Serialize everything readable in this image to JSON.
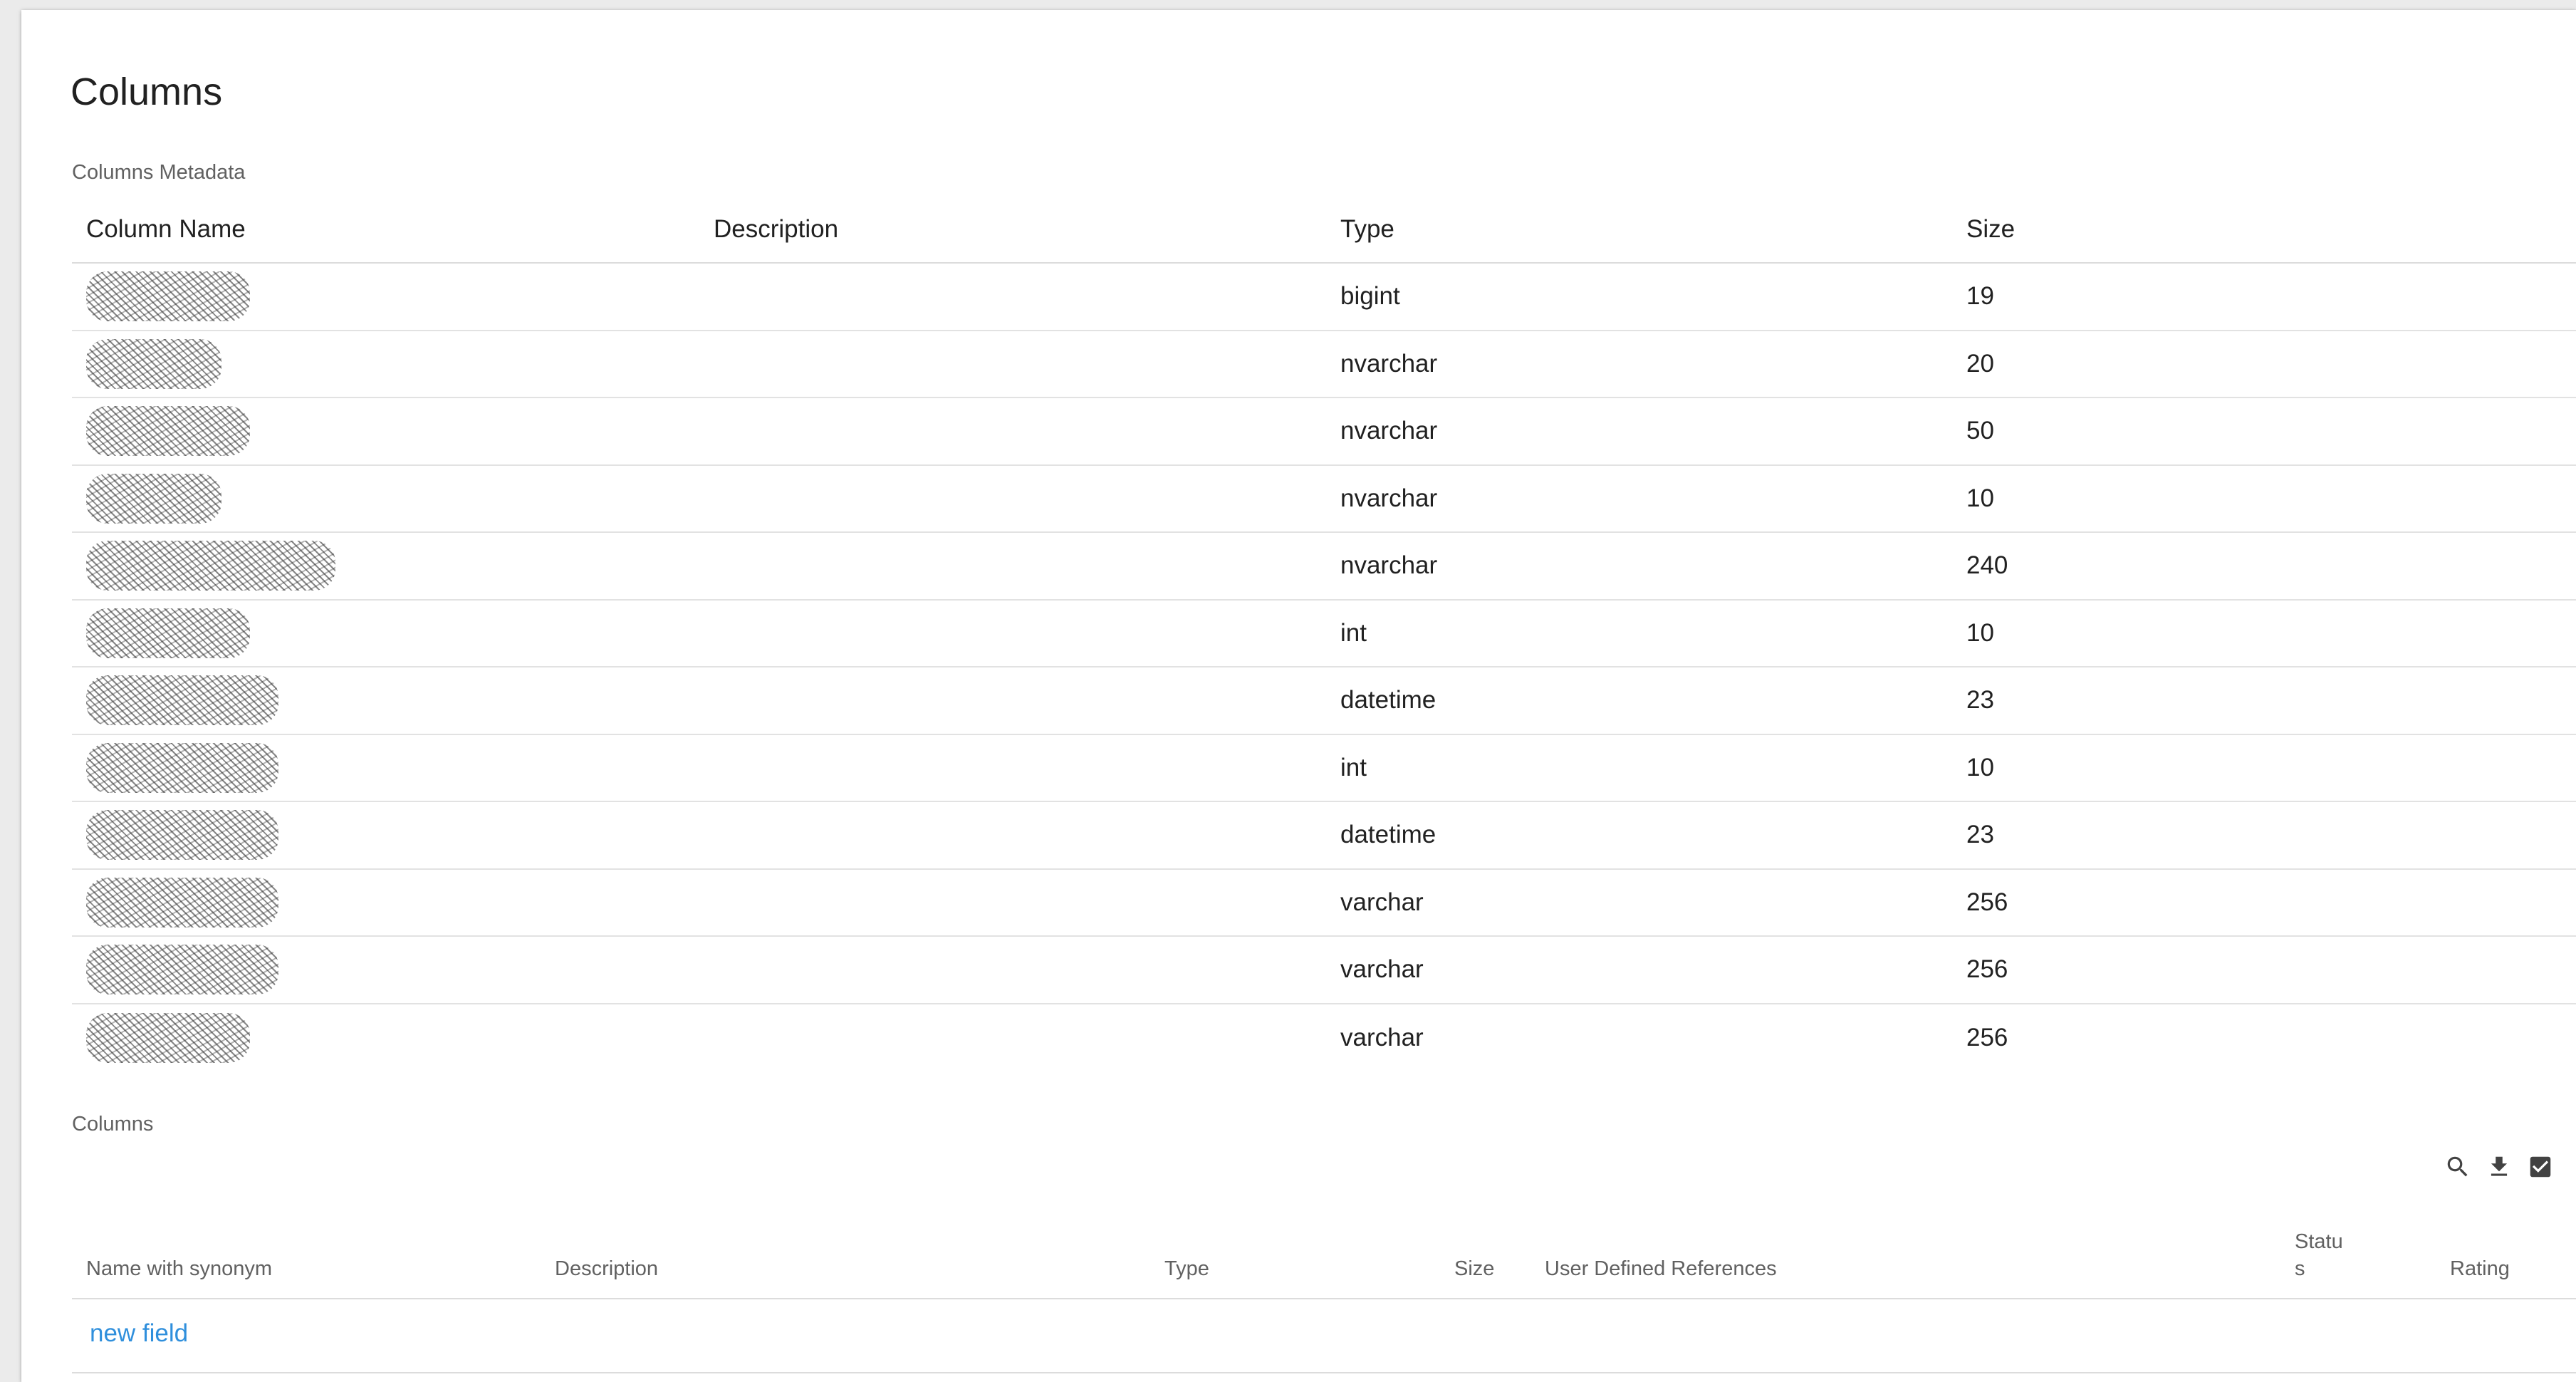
{
  "page": {
    "title": "Columns"
  },
  "metadata": {
    "section_label": "Columns Metadata",
    "headers": {
      "name": "Column Name",
      "description": "Description",
      "type": "Type",
      "size": "Size"
    },
    "rows": [
      {
        "type": "bigint",
        "size": "19"
      },
      {
        "type": "nvarchar",
        "size": "20"
      },
      {
        "type": "nvarchar",
        "size": "50"
      },
      {
        "type": "nvarchar",
        "size": "10"
      },
      {
        "type": "nvarchar",
        "size": "240"
      },
      {
        "type": "int",
        "size": "10"
      },
      {
        "type": "datetime",
        "size": "23"
      },
      {
        "type": "int",
        "size": "10"
      },
      {
        "type": "datetime",
        "size": "23"
      },
      {
        "type": "varchar",
        "size": "256"
      },
      {
        "type": "varchar",
        "size": "256"
      },
      {
        "type": "varchar",
        "size": "256"
      }
    ]
  },
  "columns": {
    "section_label": "Columns",
    "toolbar": {
      "icons": [
        "search-icon",
        "download-icon",
        "checkbox-icon"
      ]
    },
    "headers": {
      "name": "Name with synonym",
      "description": "Description",
      "type": "Type",
      "size": "Size",
      "udr": "User Defined References",
      "status": "Status",
      "rating": "Rating"
    },
    "new_field_label": "new field"
  },
  "colors": {
    "link": "#2f8fdc",
    "text": "#212121",
    "muted": "#616161"
  }
}
